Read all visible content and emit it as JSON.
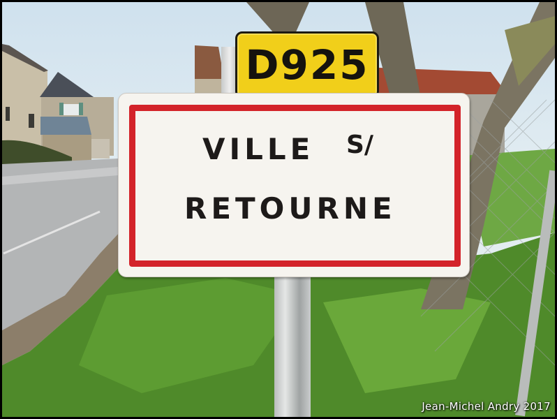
{
  "photo": {
    "route_number": "D925",
    "sign_line1": "VILLE",
    "sign_line1_suffix": "S/",
    "sign_line2": "RETOURNE",
    "credit": "Jean-Michel Andry 2017"
  },
  "colors": {
    "route_plate": "#f1cf1a",
    "sign_border": "#d3232a",
    "sign_face": "#f6f4ef",
    "grass": "#4f8a2a",
    "road": "#b8b9ba"
  }
}
